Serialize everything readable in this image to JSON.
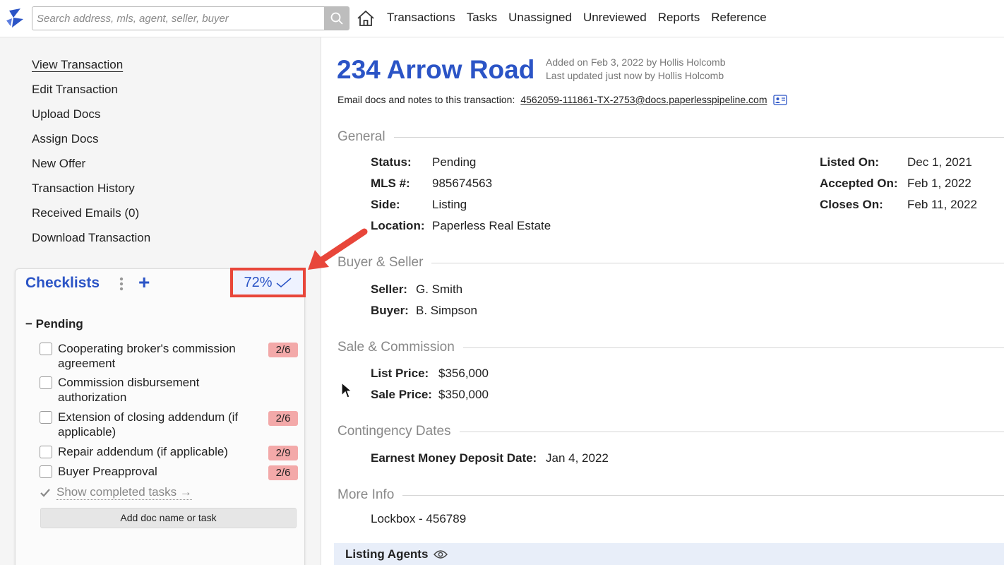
{
  "topbar": {
    "logo_icon": "paperless-pipeline-logo-icon",
    "search_placeholder": "Search address, mls, agent, seller, buyer",
    "search_icon": "search-icon",
    "home_icon": "home-icon",
    "nav": [
      "Transactions",
      "Tasks",
      "Unassigned",
      "Unreviewed",
      "Reports",
      "Reference"
    ]
  },
  "sidebar": {
    "menu": [
      "View Transaction",
      "Edit Transaction",
      "Upload Docs",
      "Assign Docs",
      "New Offer",
      "Transaction History",
      "Received Emails (0)",
      "Download Transaction"
    ],
    "active_index": 0,
    "checklists": {
      "title": "Checklists",
      "plus": "+",
      "percent": "72%",
      "group_toggle": "−",
      "group_name": "Pending",
      "items": [
        {
          "label": "Cooperating broker's commission agreement",
          "badge": "2/6"
        },
        {
          "label": "Commission disbursement authorization",
          "badge": ""
        },
        {
          "label": "Extension of closing addendum (if applicable)",
          "badge": "2/6"
        },
        {
          "label": "Repair addendum (if applicable)",
          "badge": "2/9"
        },
        {
          "label": "Buyer Preapproval",
          "badge": "2/6"
        }
      ],
      "show_completed": "Show completed tasks →",
      "add_task": "Add doc name or task"
    }
  },
  "main": {
    "address": "234 Arrow Road",
    "added": "Added on Feb 3, 2022 by Hollis Holcomb",
    "updated": "Last updated just now by Hollis Holcomb",
    "email_label": "Email docs and notes to this transaction:",
    "email_address": "4562059-111861-TX-2753@docs.paperlesspipeline.com",
    "general": {
      "heading": "General",
      "status_label": "Status:",
      "status": "Pending",
      "mls_label": "MLS #:",
      "mls": "985674563",
      "side_label": "Side:",
      "side": "Listing",
      "location_label": "Location:",
      "location": "Paperless Real Estate",
      "listed_label": "Listed On:",
      "listed": "Dec 1, 2021",
      "accepted_label": "Accepted On:",
      "accepted": "Feb 1, 2022",
      "closes_label": "Closes On:",
      "closes": "Feb 11, 2022"
    },
    "buyer_seller": {
      "heading": "Buyer & Seller",
      "seller_label": "Seller:",
      "seller": "G. Smith",
      "buyer_label": "Buyer:",
      "buyer": "B. Simpson"
    },
    "sale": {
      "heading": "Sale & Commission",
      "list_label": "List Price:",
      "list": "$356,000",
      "sale_label": "Sale Price:",
      "sale": "$350,000"
    },
    "contingency": {
      "heading": "Contingency Dates",
      "emd_label": "Earnest Money Deposit Date:",
      "emd": "Jan 4, 2022"
    },
    "more_info": {
      "heading": "More Info",
      "text": "Lockbox - 456789"
    },
    "listing_agents": "Listing Agents"
  },
  "colors": {
    "accent": "#2b54c6",
    "highlight_box": "#e8463a",
    "badge": "#f3a9a9"
  }
}
